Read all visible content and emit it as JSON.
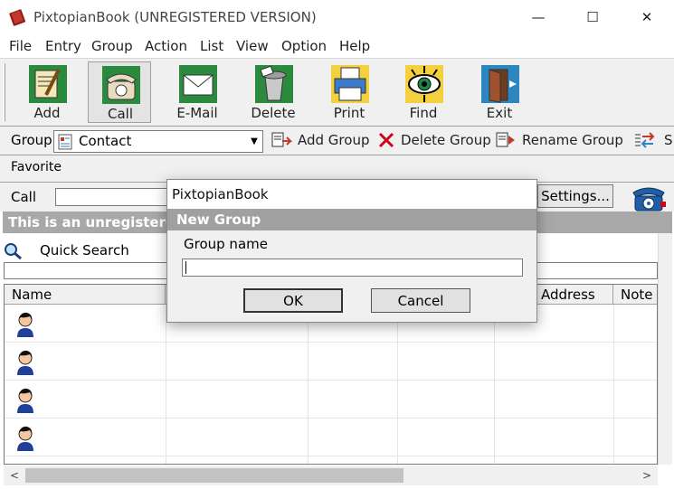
{
  "window": {
    "title": "PixtopianBook (UNREGISTERED VERSION)",
    "minimize_glyph": "—",
    "maximize_glyph": "☐",
    "close_glyph": "✕"
  },
  "menu": [
    "File",
    "Entry",
    "Group",
    "Action",
    "List",
    "View",
    "Option",
    "Help"
  ],
  "toolbar": {
    "buttons": [
      {
        "label": "Add",
        "icon": "notepad-pen-icon"
      },
      {
        "label": "Call",
        "icon": "telephone-icon"
      },
      {
        "label": "E-Mail",
        "icon": "envelope-icon"
      },
      {
        "label": "Delete",
        "icon": "trash-can-icon"
      },
      {
        "label": "Print",
        "icon": "printer-icon"
      },
      {
        "label": "Find",
        "icon": "eye-icon"
      },
      {
        "label": "Exit",
        "icon": "door-exit-icon"
      }
    ]
  },
  "groupbar": {
    "label": "Group",
    "selected": "Contact",
    "actions": [
      "Add Group",
      "Delete Group",
      "Rename Group",
      "S"
    ]
  },
  "favorite": {
    "label": "Favorite"
  },
  "callbar": {
    "label": "Call",
    "value": "",
    "settings_label": "Settings..."
  },
  "banner": "This is an unregistered",
  "quick_search": {
    "label": "Quick Search",
    "value": ""
  },
  "table": {
    "columns": [
      "Name",
      "",
      "",
      "",
      "Address",
      "Note"
    ],
    "rows": 4
  },
  "dialog": {
    "title": "PixtopianBook",
    "header": "New Group",
    "field_label": "Group name",
    "field_value": "",
    "ok_label": "OK",
    "cancel_label": "Cancel"
  },
  "colors": {
    "banner": "#a8a8a8",
    "dialog_header": "#a0a0a0",
    "toolbar_bg": "#f0f0f0"
  }
}
